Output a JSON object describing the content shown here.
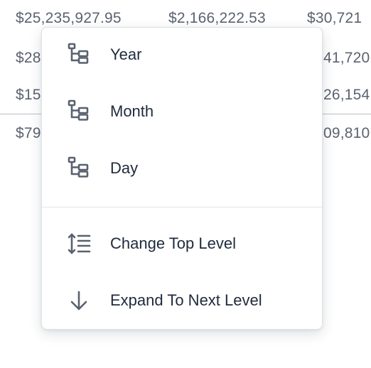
{
  "table": {
    "rows": [
      [
        "$25,235,927.95",
        "$2,166,222.53",
        "$30,721"
      ],
      [
        "$28",
        "",
        "41,720"
      ],
      [
        "$15",
        "",
        "26,154"
      ],
      [
        "$79",
        "",
        "09,810"
      ]
    ]
  },
  "menu": {
    "items": [
      {
        "label": "Year",
        "icon": "hierarchy-icon"
      },
      {
        "label": "Month",
        "icon": "hierarchy-icon"
      },
      {
        "label": "Day",
        "icon": "hierarchy-icon"
      },
      {
        "label": "Change Top Level",
        "icon": "list-sort-icon"
      },
      {
        "label": "Expand To Next Level",
        "icon": "arrow-down-icon"
      }
    ]
  }
}
